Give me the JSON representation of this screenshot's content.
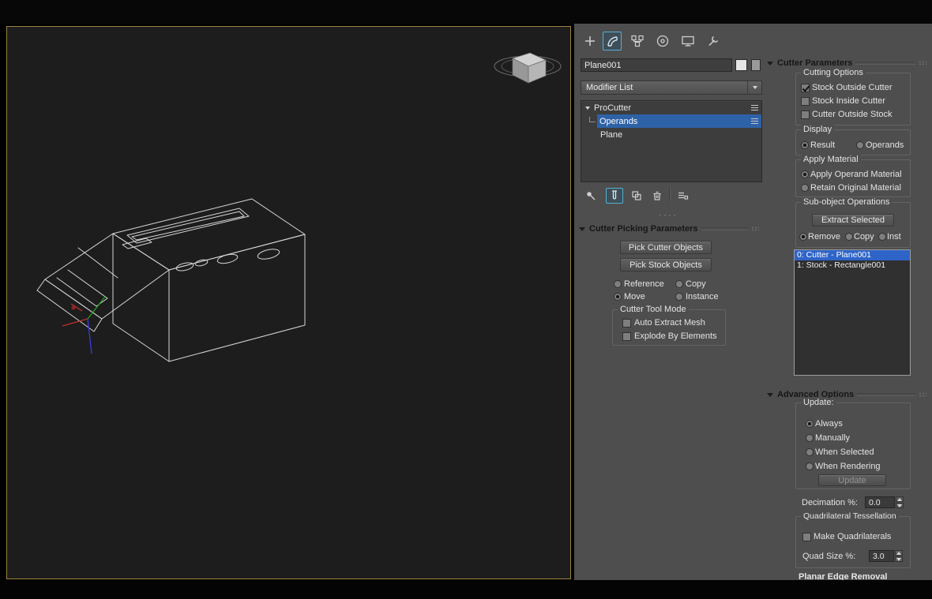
{
  "colors": {
    "selection_blue": "#2e62a8",
    "list_selection_blue": "#2e64c8",
    "viewport_border": "#9a8440",
    "panel_bg": "#4e4e4e",
    "active_tab_outline": "#56b0d4",
    "axis_x": "#c03030",
    "axis_y": "#20a020",
    "axis_z": "#3a3ae0"
  },
  "panel": {
    "tabs": {
      "icons": [
        "create-icon",
        "modify-icon",
        "hierarchy-icon",
        "motion-icon",
        "display-icon",
        "utilities-icon"
      ],
      "active": "modify"
    },
    "object_name": "Plane001",
    "modifier_list_label": "Modifier List",
    "stack": {
      "rows": [
        {
          "label": "ProCutter",
          "expanded": true,
          "selected": false
        },
        {
          "label": "Operands",
          "expanded": false,
          "selected": true
        },
        {
          "label": "Plane",
          "expanded": false,
          "selected": false
        }
      ],
      "tools": [
        "pin-stack-icon",
        "show-end-result-icon",
        "make-unique-icon",
        "remove-modifier-icon",
        "configure-modifier-sets-icon"
      ],
      "active_tool": "show-end-result"
    },
    "picking": {
      "title": "Cutter Picking Parameters",
      "pick_cutter_button": "Pick Cutter Objects",
      "pick_stock_button": "Pick Stock Objects",
      "reference": "Reference",
      "copy": "Copy",
      "move": "Move",
      "instance": "Instance",
      "pick_mode": "Move",
      "tool_mode": {
        "title": "Cutter Tool Mode",
        "auto_extract": "Auto Extract Mesh",
        "auto_extract_checked": false,
        "explode": "Explode By Elements",
        "explode_checked": false
      }
    },
    "cutter_parameters": {
      "title": "Cutter Parameters",
      "cutting_options": {
        "title": "Cutting Options",
        "stock_outside": "Stock Outside Cutter",
        "stock_outside_checked": true,
        "stock_inside": "Stock Inside Cutter",
        "stock_inside_checked": false,
        "cutter_outside": "Cutter Outside Stock",
        "cutter_outside_checked": false
      },
      "display": {
        "title": "Display",
        "result": "Result",
        "operands": "Operands",
        "selected": "Result"
      },
      "apply_material": {
        "title": "Apply Material",
        "apply": "Apply Operand Material",
        "retain": "Retain Original Material",
        "selected": "Apply Operand Material"
      },
      "subobject": {
        "title": "Sub-object Operations",
        "extract_button": "Extract Selected",
        "remove": "Remove",
        "copy": "Copy",
        "inst": "Inst",
        "selected": "Remove"
      },
      "operands": [
        {
          "label": "0: Cutter - Plane001",
          "selected": true
        },
        {
          "label": "1: Stock - Rectangle001",
          "selected": false
        }
      ]
    },
    "advanced": {
      "title": "Advanced Options",
      "update": {
        "title": "Update:",
        "always": "Always",
        "manually": "Manually",
        "when_selected": "When Selected",
        "when_rendering": "When Rendering",
        "selected": "Always",
        "button": "Update",
        "button_enabled": false
      },
      "decimation_label": "Decimation %:",
      "decimation_value": "0.0",
      "quad": {
        "title": "Quadrilateral Tessellation",
        "make_quads": "Make Quadrilaterals",
        "make_quads_checked": false,
        "size_label": "Quad Size %:",
        "size_value": "3.0"
      },
      "planar_label": "Planar Edge Removal"
    }
  }
}
